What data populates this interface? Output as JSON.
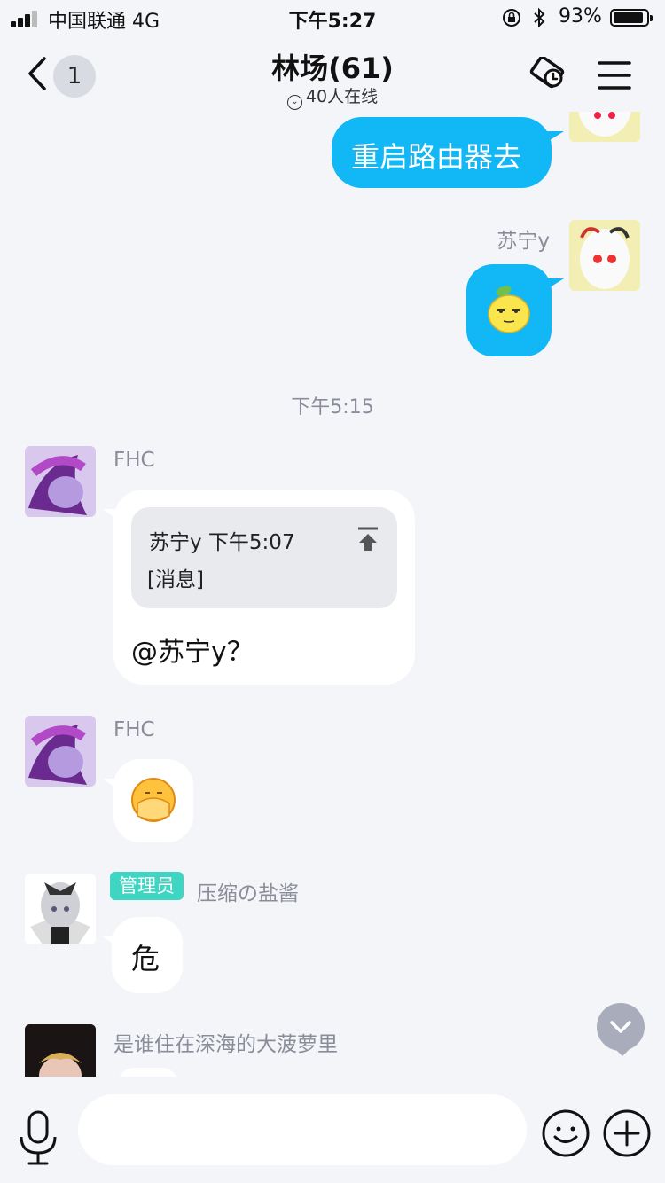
{
  "status": {
    "carrier": "中国联通  4G",
    "time": "下午5:27",
    "battery": "93%",
    "battery_level": 0.93
  },
  "nav": {
    "unread": "1",
    "title": "林场(61)",
    "online": "40人在线"
  },
  "messages": {
    "m1": {
      "text": "重启路由器去"
    },
    "m2": {
      "sender": "苏宁y"
    },
    "time_divider": "下午5:15",
    "m3": {
      "sender": "FHC",
      "quote_header": "苏宁y 下午5:07",
      "quote_body": "[消息]",
      "text": "@苏宁y？"
    },
    "m4": {
      "sender": "FHC"
    },
    "m5": {
      "badge": "管理员",
      "sender": "压缩の盐酱",
      "text": "危"
    },
    "m6": {
      "sender": "是谁住在深海的大菠萝里"
    }
  },
  "input": {
    "placeholder": ""
  }
}
